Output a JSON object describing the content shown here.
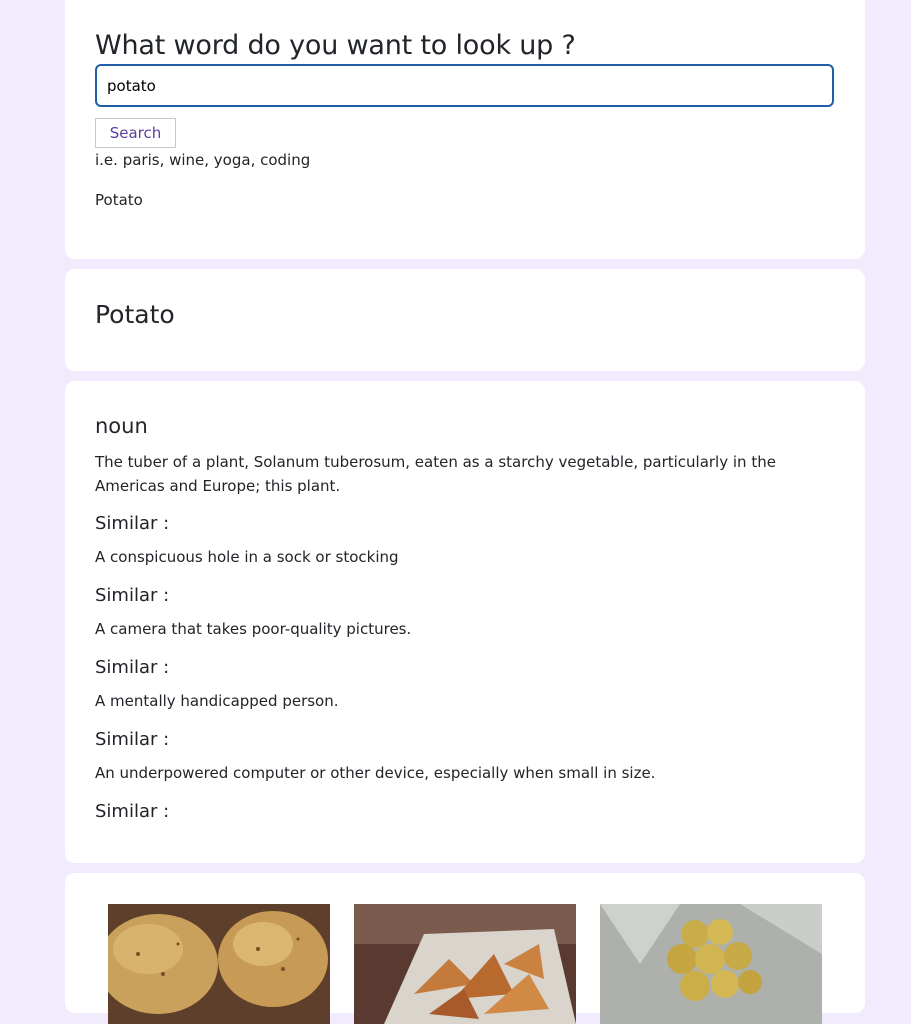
{
  "search": {
    "heading": "What word do you want to look up ?",
    "input_value": "potato",
    "button_label": "Search",
    "hint": "i.e. paris, wine, yoga, coding",
    "result_word": "Potato"
  },
  "word": {
    "title": "Potato"
  },
  "meaning": {
    "part_of_speech": "noun",
    "definition": "The tuber of a plant, Solanum tuberosum, eaten as a starchy vegetable, particularly in the Americas and Europe; this plant.",
    "similar": [
      {
        "label": "Similar :",
        "text": "A conspicuous hole in a sock or stocking"
      },
      {
        "label": "Similar :",
        "text": "A camera that takes poor-quality pictures."
      },
      {
        "label": "Similar :",
        "text": "A mentally handicapped person."
      },
      {
        "label": "Similar :",
        "text": "An underpowered computer or other device, especially when small in size."
      },
      {
        "label": "Similar :",
        "text": ""
      }
    ]
  },
  "photos": [
    {
      "subject": "raw potatoes on wooden board"
    },
    {
      "subject": "roasted potato wedges in basket"
    },
    {
      "subject": "small yellow potatoes in net"
    }
  ],
  "colors": {
    "page_background": "#f1ebfd",
    "card_background": "#ffffff",
    "input_border": "#1f5fa8",
    "button_text": "#5b3fa1"
  }
}
